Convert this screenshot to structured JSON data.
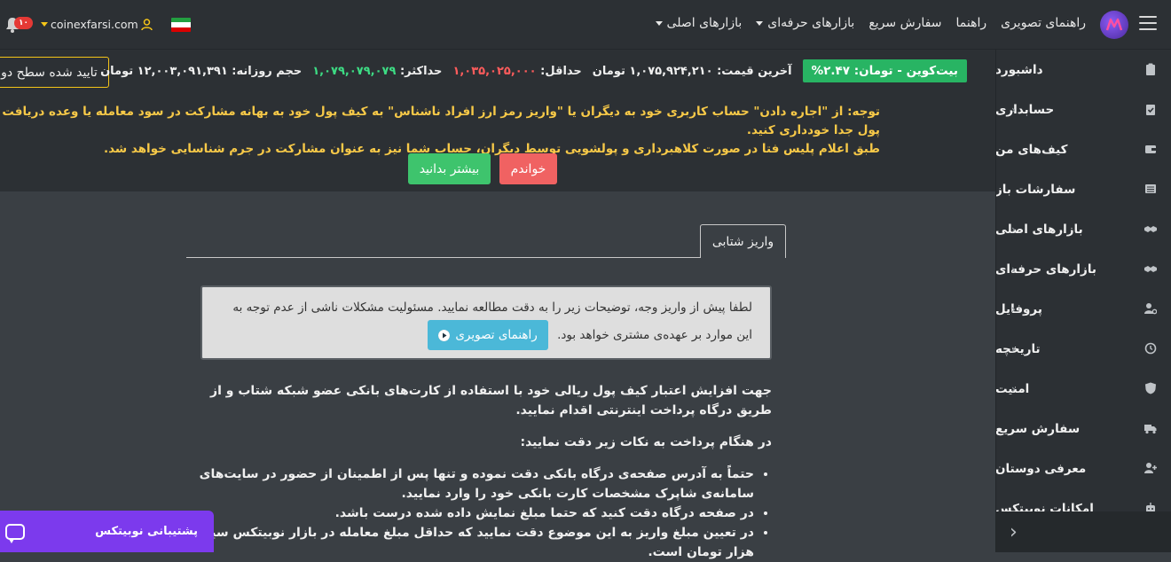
{
  "nav": {
    "links": [
      {
        "label": "بازارهای اصلی",
        "caret": true
      },
      {
        "label": "بازارهای حرفه‌ای",
        "caret": true
      },
      {
        "label": "سفارش سریع",
        "caret": false
      },
      {
        "label": "راهنما",
        "caret": false
      },
      {
        "label": "راهنمای تصویری",
        "caret": false
      }
    ],
    "username": "coinexfarsi.com",
    "notification_count": "۱۰"
  },
  "ticker": {
    "pair": "بیت‌کوین - تومان: ۲.۴۷%",
    "last_price_label": "آخرین قیمت:",
    "last_price": "۱,۰۷۵,۹۲۴,۲۱۰ تومان",
    "min_label": "حداقل:",
    "min_value": "۱,۰۳۵,۰۲۵,۰۰۰",
    "max_label": "حداکثر:",
    "max_value": "۱,۰۷۹,۰۷۹,۰۷۹",
    "volume_label": "حجم روزانه:",
    "volume_value": "۱۲,۰۰۳,۰۹۱,۳۹۱ تومان"
  },
  "verify_button": "تایید شده سطح دو",
  "warning": {
    "line1": "توجه: از \"اجاره دادن\" حساب کاربری خود به دیگران یا \"واریز رمز ارز افراد ناشناس\" به کیف پول خود به بهانه مشارکت در سود معامله یا وعده دریافت پول جدا خودداری کنید.",
    "line2": "طبق اعلام پلیس فتا در صورت کلاهبرداری و پولشویی توسط دیگران، حساب شما نیز به عنوان مشارکت در جرم شناسایی خواهد شد.",
    "read_button": "خواندم",
    "more_button": "بیشتر بدانید"
  },
  "tab": "واریز شتابی",
  "notice": {
    "text": "لطفا پیش از واریز وجه، توضیحات زیر را به دقت مطالعه نمایید. مسئولیت مشکلات ناشی از عدم توجه به این موارد بر عهده‌ی مشتری خواهد بود.",
    "guide_button": "راهنمای تصویری"
  },
  "content": {
    "intro": "جهت افزایش اعتبار کیف پول ریالی خود با استفاده از کارت‌های بانکی عضو شبکه شتاب و از طریق درگاه پرداخت اینترنتی اقدام نمایید.",
    "heading": "در هنگام پرداخت به نکات زیر دقت نمایید:",
    "bullets": [
      "حتماً به آدرس صفحه‌ی درگاه بانکی دقت نموده و تنها پس از اطمینان از حضور در سایت‌های سامانه‌ی شاپرک مشخصات کارت بانکی خود را وارد نمایید.",
      "در صفحه درگاه دقت کنید که حتما مبلغ نمایش داده شده درست باشد.",
      "در تعیین مبلغ واریز به این موضوع دقت نمایید که حداقل مبلغ معامله در بازار نوبیتکس سیصد هزار تومان است."
    ]
  },
  "sidebar": {
    "items": [
      {
        "label": "داشبورد",
        "icon": "clipboard-icon",
        "chev": false
      },
      {
        "label": "حسابداری",
        "icon": "clipboard-check-icon",
        "chev": true
      },
      {
        "label": "کیف‌های من",
        "icon": "wallet-icon",
        "chev": false
      },
      {
        "label": "سفارشات باز",
        "icon": "list-icon",
        "chev": false
      },
      {
        "label": "بازارهای اصلی",
        "icon": "handshake-icon",
        "chev": true
      },
      {
        "label": "بازارهای حرفه‌ای",
        "icon": "handshake-icon",
        "chev": true
      },
      {
        "label": "پروفایل",
        "icon": "user-gear-icon",
        "chev": true
      },
      {
        "label": "تاریخچه",
        "icon": "history-icon",
        "chev": true
      },
      {
        "label": "امنیت",
        "icon": "shield-icon",
        "chev": true
      },
      {
        "label": "سفارش سریع",
        "icon": "truck-icon",
        "chev": false
      },
      {
        "label": "معرفی دوستان",
        "icon": "user-plus-icon",
        "chev": false
      },
      {
        "label": "امکانات نوبیتکس",
        "icon": "robot-icon",
        "chev": false
      }
    ]
  },
  "support": {
    "label": "پشتیبانی نوبیتکس"
  },
  "colors": {
    "accent": "#7c3aed",
    "success": "#28b463",
    "danger": "#f06262",
    "warning": "#f7c948",
    "info": "#4bb8d8"
  }
}
